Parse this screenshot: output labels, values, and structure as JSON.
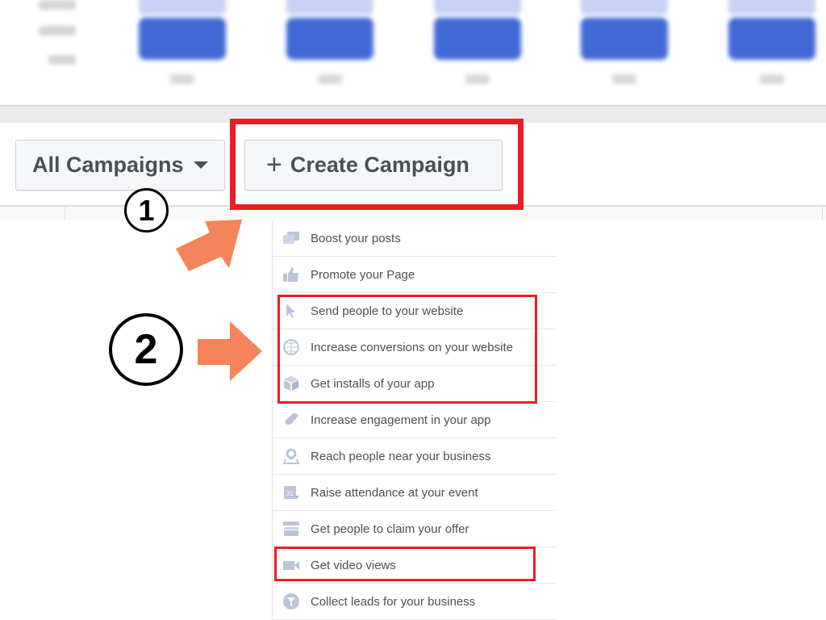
{
  "toolbar": {
    "all_campaigns_label": "All Campaigns",
    "create_campaign_label": "Create Campaign"
  },
  "menu": {
    "items": [
      {
        "label": "Boost your posts",
        "icon": "speech-bubbles-icon"
      },
      {
        "label": "Promote your Page",
        "icon": "thumbs-up-icon"
      },
      {
        "label": "Send people to your website",
        "icon": "cursor-icon"
      },
      {
        "label": "Increase conversions on your website",
        "icon": "globe-icon"
      },
      {
        "label": "Get installs of your app",
        "icon": "box-icon"
      },
      {
        "label": "Increase engagement in your app",
        "icon": "gamepad-icon"
      },
      {
        "label": "Reach people near your business",
        "icon": "map-pin-icon"
      },
      {
        "label": "Raise attendance at your event",
        "icon": "calendar-icon"
      },
      {
        "label": "Get people to claim your offer",
        "icon": "store-icon"
      },
      {
        "label": "Get video views",
        "icon": "video-camera-icon"
      },
      {
        "label": "Collect leads for your business",
        "icon": "funnel-icon"
      }
    ]
  },
  "annotations": {
    "step1": "1",
    "step2": "2"
  },
  "colors": {
    "highlight": "#ed1c24",
    "arrow": "#f5845a",
    "bar": "#4169d6"
  }
}
